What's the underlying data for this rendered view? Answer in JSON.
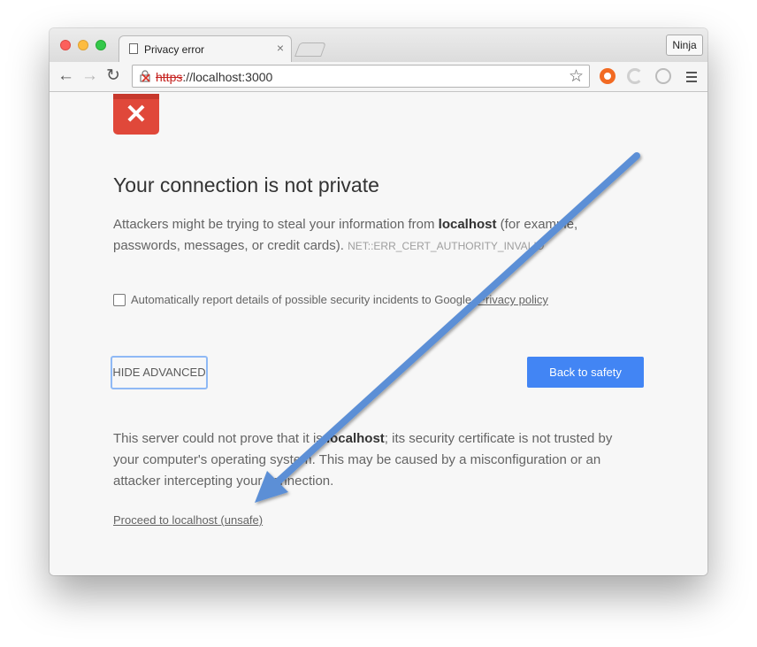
{
  "browser": {
    "tab_title": "Privacy error",
    "tab_close": "×",
    "profile_label": "Ninja",
    "url_scheme": "https",
    "url_rest": "://localhost:3000",
    "star_glyph": "☆",
    "icons": {
      "back": "back-arrow-icon",
      "forward": "forward-arrow-icon",
      "reload": "reload-icon",
      "lock": "broken-lock-icon",
      "menu": "hamburger-menu-icon"
    }
  },
  "error": {
    "icon_glyph": "✕",
    "heading": "Your connection is not private",
    "para1_a": "Attackers might be trying to steal your information from ",
    "para1_host": "localhost",
    "para1_b": " (for example, passwords, messages, or credit cards). ",
    "error_code": "NET::ERR_CERT_AUTHORITY_INVALID",
    "report_text": "Automatically report details of possible security incidents to Google. ",
    "privacy_link": "Privacy policy",
    "hide_advanced": "HIDE ADVANCED",
    "back_to_safety": "Back to safety",
    "para2_a": "This server could not prove that it is ",
    "para2_host": "localhost",
    "para2_b": "; its security certificate is not trusted by your computer's operating system. This may be caused by a misconfiguration or an attacker intercepting your connection.",
    "proceed_link": "Proceed to localhost (unsafe)"
  },
  "colors": {
    "accent": "#4285f4",
    "error_red": "#e0483a",
    "annotation_arrow": "#5b8fd6"
  }
}
